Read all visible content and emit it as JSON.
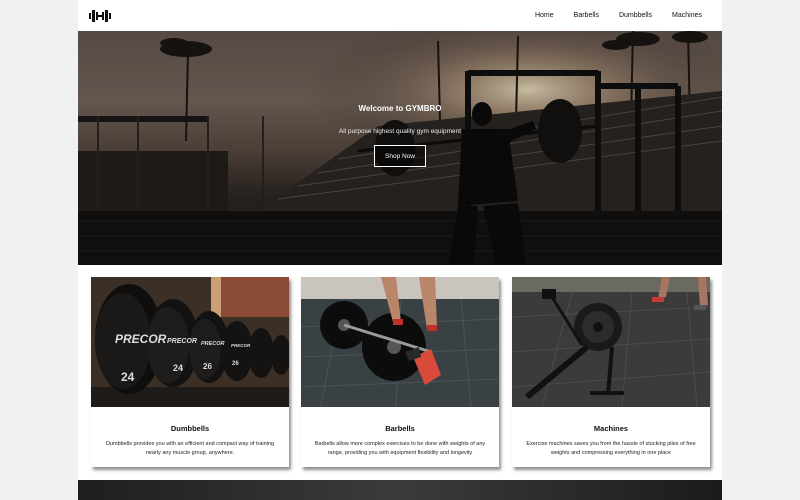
{
  "nav": {
    "logo_icon": "dumbbell-icon",
    "links": [
      "Home",
      "Barbells",
      "Dumbbells",
      "Machines"
    ]
  },
  "hero": {
    "title": "Welcome to GYMBRO",
    "subtitle": "All purpose highest quality gym equipment",
    "button": "Shop Now"
  },
  "cards": [
    {
      "title": "Dumbbells",
      "description": "Dumbbells provides you with an efficient and compact way of training nearly any muscle group, anywhere.",
      "image_icon": "dumbbell-rack-photo",
      "plate_brand": "PRECOR",
      "plate_number": "24"
    },
    {
      "title": "Barbells",
      "description": "Barbells allow more complex exercises to be done with weights of any range, providing you with equipment flexibility and longevity",
      "image_icon": "barbell-lift-photo"
    },
    {
      "title": "Machines",
      "description": "Exercise machines saves you from the hassle of stocking piles of free weights and compressing everything in one place",
      "image_icon": "rowing-machine-photo"
    }
  ],
  "colors": {
    "page_bg": "#f1f1f1",
    "card_bg": "#ffffff",
    "text": "#111111"
  }
}
